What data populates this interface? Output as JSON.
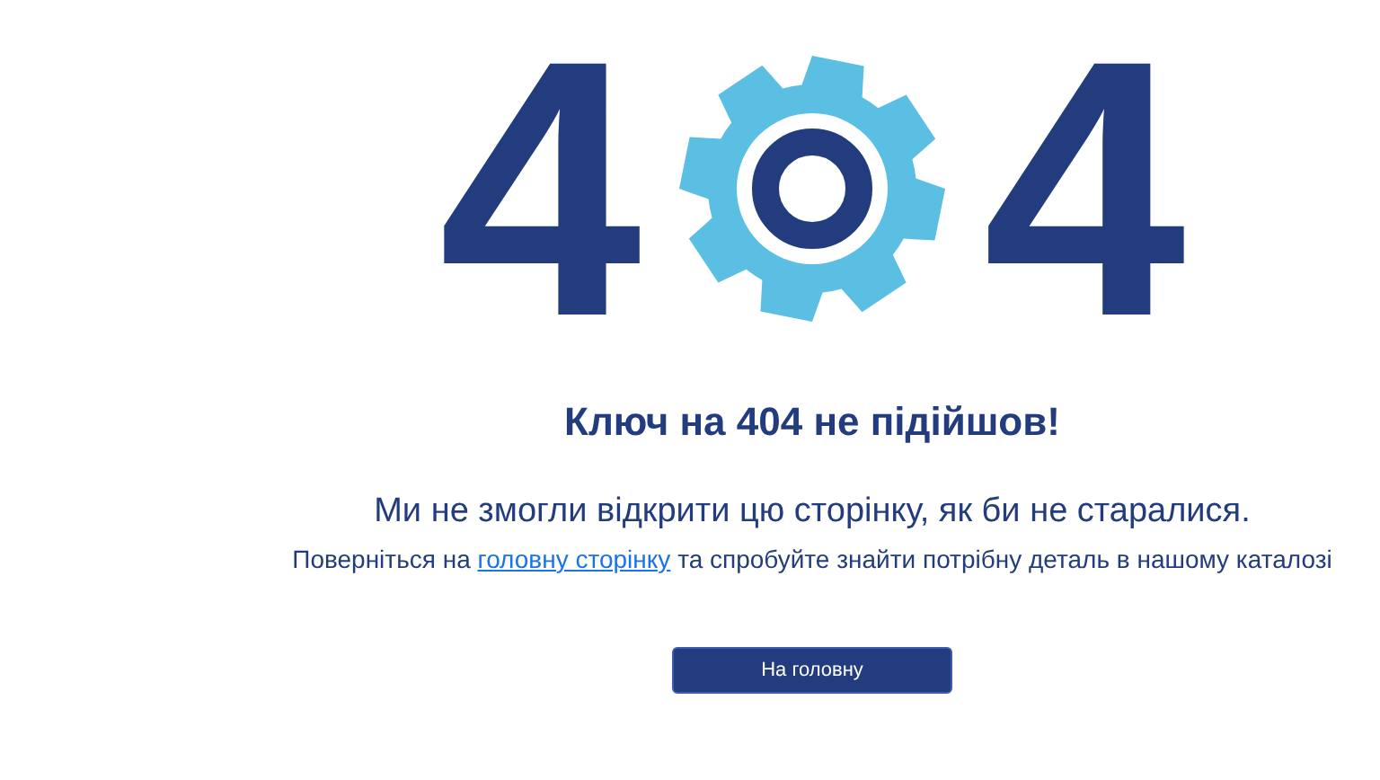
{
  "logo": {
    "left_digit": "4",
    "right_digit": "4"
  },
  "title": "Ключ на 404 не підійшов!",
  "subtitle": "Ми не змогли відкрити цю сторінку, як би не старалися.",
  "hint": {
    "before": "Поверніться на",
    "link": "головну сторінку",
    "after": "та спробуйте знайти потрібну деталь в нашому каталозі"
  },
  "button": "На головну"
}
